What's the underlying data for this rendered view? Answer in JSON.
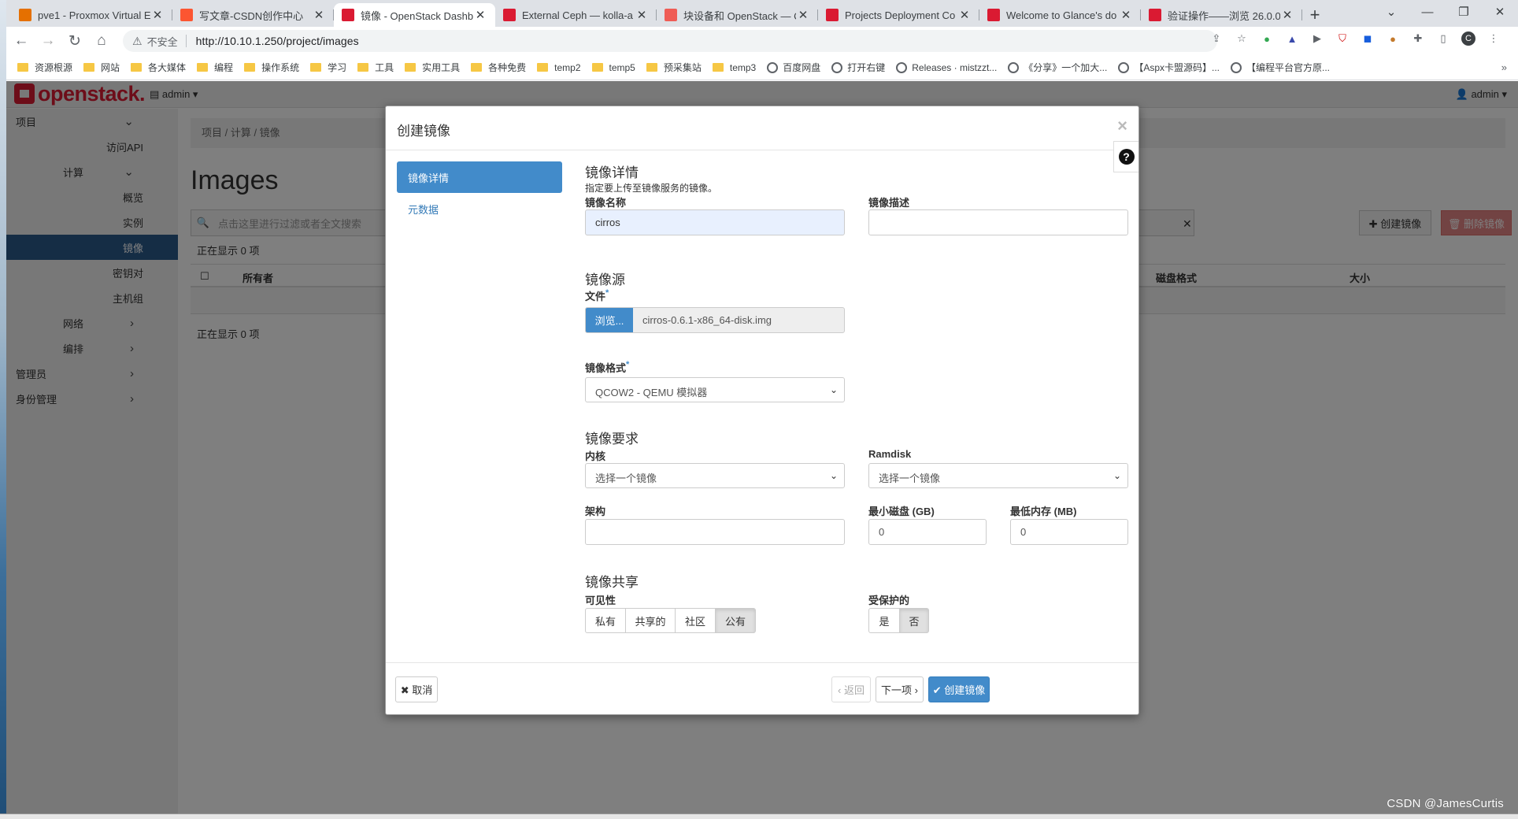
{
  "browser": {
    "tabs": [
      {
        "title": "pve1 - Proxmox Virtual E",
        "icon": "proxmox-icon",
        "color": "#e57000",
        "active": false
      },
      {
        "title": "写文章-CSDN创作中心",
        "icon": "csdn-icon",
        "color": "#fc5531",
        "active": false
      },
      {
        "title": "镜像 - OpenStack Dashb",
        "icon": "openstack-icon",
        "color": "#da1a32",
        "active": true
      },
      {
        "title": "External Ceph — kolla-a",
        "icon": "openstack-icon",
        "color": "#da1a32",
        "active": false
      },
      {
        "title": "块设备和 OpenStack — C",
        "icon": "ceph-icon",
        "color": "#ef5c55",
        "active": false
      },
      {
        "title": "Projects Deployment Co",
        "icon": "openstack-icon",
        "color": "#da1a32",
        "active": false
      },
      {
        "title": "Welcome to Glance's do",
        "icon": "openstack-icon",
        "color": "#da1a32",
        "active": false
      },
      {
        "title": "验证操作——浏览 26.0.0.",
        "icon": "openstack-icon",
        "color": "#da1a32",
        "active": false
      }
    ],
    "security_label": "不安全",
    "url": "http://10.10.1.250/project/images",
    "profile_initial": "C",
    "bookmarks": [
      {
        "label": "资源根源",
        "type": "folder"
      },
      {
        "label": "网站",
        "type": "folder"
      },
      {
        "label": "各大媒体",
        "type": "folder"
      },
      {
        "label": "编程",
        "type": "folder"
      },
      {
        "label": "操作系统",
        "type": "folder"
      },
      {
        "label": "学习",
        "type": "folder"
      },
      {
        "label": "工具",
        "type": "folder"
      },
      {
        "label": "实用工具",
        "type": "folder"
      },
      {
        "label": "各种免费",
        "type": "folder"
      },
      {
        "label": "temp2",
        "type": "folder"
      },
      {
        "label": "temp5",
        "type": "folder"
      },
      {
        "label": "预采集站",
        "type": "folder"
      },
      {
        "label": "temp3",
        "type": "folder"
      },
      {
        "label": "百度网盘",
        "type": "globe"
      },
      {
        "label": "打开右键",
        "type": "globe"
      },
      {
        "label": "Releases · mistzzt...",
        "type": "globe"
      },
      {
        "label": "《分享》一个加大...",
        "type": "globe"
      },
      {
        "label": "【Aspx卡盟源码】...",
        "type": "globe"
      },
      {
        "label": "【编程平台官方原...",
        "type": "globe"
      }
    ]
  },
  "openstack": {
    "logo": "openstack.",
    "project_selector": "admin ▾",
    "user_menu": "admin ▾",
    "sidebar": [
      {
        "label": "项目",
        "level": 0,
        "chevron": "⌄"
      },
      {
        "label": "访问API",
        "level": 2,
        "chevron": ""
      },
      {
        "label": "计算",
        "level": 1,
        "chevron": "⌄"
      },
      {
        "label": "概览",
        "level": 2,
        "chevron": ""
      },
      {
        "label": "实例",
        "level": 2,
        "chevron": ""
      },
      {
        "label": "镜像",
        "level": 2,
        "chevron": "",
        "active": true
      },
      {
        "label": "密钥对",
        "level": 2,
        "chevron": ""
      },
      {
        "label": "主机组",
        "level": 2,
        "chevron": ""
      },
      {
        "label": "网络",
        "level": 1,
        "chevron": "›"
      },
      {
        "label": "编排",
        "level": 1,
        "chevron": "›"
      },
      {
        "label": "管理员",
        "level": 0,
        "chevron": "›"
      },
      {
        "label": "身份管理",
        "level": 0,
        "chevron": "›"
      }
    ],
    "breadcrumb": "项目 / 计算 / 镜像",
    "page_title": "Images",
    "filter_placeholder": "点击这里进行过滤或者全文搜索",
    "create_button": "✚ 创建镜像",
    "delete_button": "🗑 删除镜像",
    "showing_text": "正在显示 0 项",
    "columns": {
      "owner": "所有者",
      "disk_format": "磁盘格式",
      "size": "大小"
    }
  },
  "modal": {
    "title": "创建镜像",
    "close": "×",
    "steps": [
      {
        "label": "镜像详情",
        "active": true
      },
      {
        "label": "元数据",
        "active": false
      }
    ],
    "details": {
      "title": "镜像详情",
      "subtitle": "指定要上传至镜像服务的镜像。",
      "name_label": "镜像名称",
      "name_value": "cirros",
      "description_label": "镜像描述",
      "description_value": ""
    },
    "source": {
      "title": "镜像源",
      "file_label": "文件",
      "browse_button": "浏览...",
      "file_name": "cirros-0.6.1-x86_64-disk.img",
      "format_label": "镜像格式",
      "format_value": "QCOW2 - QEMU 模拟器"
    },
    "requirements": {
      "title": "镜像要求",
      "kernel_label": "内核",
      "kernel_value": "选择一个镜像",
      "ramdisk_label": "Ramdisk",
      "ramdisk_value": "选择一个镜像",
      "arch_label": "架构",
      "arch_value": "",
      "min_disk_label": "最小磁盘 (GB)",
      "min_disk_value": "0",
      "min_ram_label": "最低内存 (MB)",
      "min_ram_value": "0"
    },
    "sharing": {
      "title": "镜像共享",
      "visibility_label": "可见性",
      "visibility_options": [
        "私有",
        "共享的",
        "社区",
        "公有"
      ],
      "visibility_selected": "公有",
      "protected_label": "受保护的",
      "protected_options": [
        "是",
        "否"
      ],
      "protected_selected": "否"
    },
    "footer": {
      "cancel": "✖ 取消",
      "back": "‹ 返回",
      "next": "下一项 ›",
      "submit": "✔ 创建镜像"
    }
  },
  "watermark": "CSDN @JamesCurtis"
}
